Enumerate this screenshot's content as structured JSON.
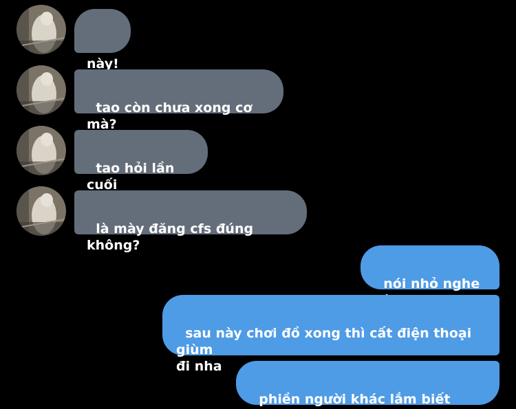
{
  "conversation": {
    "incoming": [
      {
        "text": "này!"
      },
      {
        "text": "tao còn chưa xong cơ mà?"
      },
      {
        "text": "tao hỏi lần cuối"
      },
      {
        "text": "là mày đăng cfs đúng không?"
      }
    ],
    "outgoing": [
      {
        "text": "nói nhỏ nghe nè"
      },
      {
        "text": "sau này chơi đồ xong thì cất điện thoại giùm\nđi nha"
      },
      {
        "text": "phiền người khác lắm biết không?"
      }
    ]
  },
  "colors": {
    "background": "#000000",
    "incoming_bubble": "#646e7a",
    "outgoing_bubble": "#4e9be6",
    "text": "#ffffff"
  },
  "icons": {
    "avatar": "contact-avatar-photo"
  }
}
